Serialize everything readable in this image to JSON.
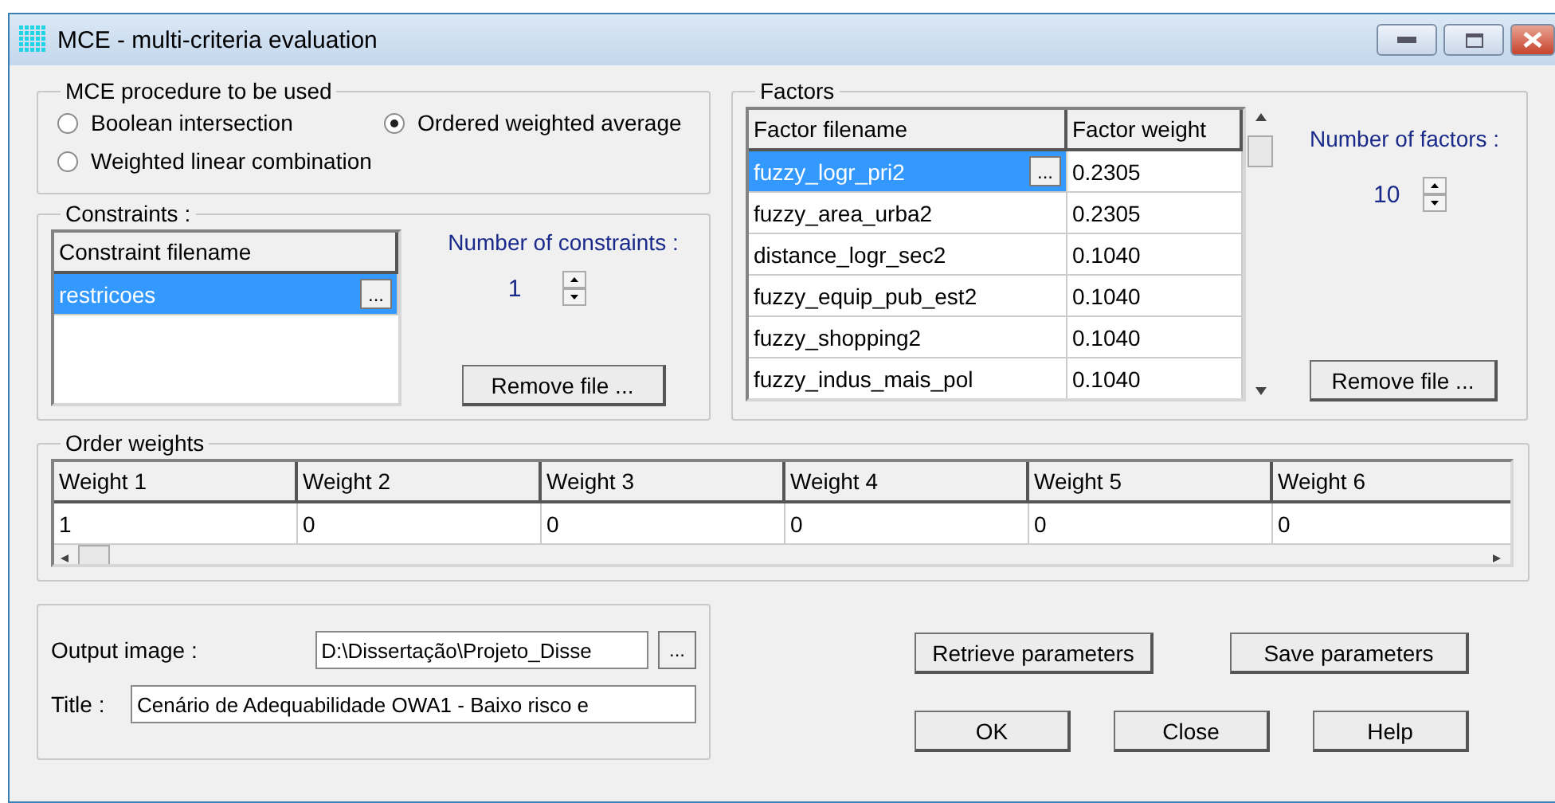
{
  "window": {
    "title": "MCE - multi-criteria evaluation"
  },
  "procedure": {
    "label": "MCE procedure to be used",
    "options": [
      {
        "label": "Boolean intersection",
        "selected": false
      },
      {
        "label": "Ordered weighted average",
        "selected": true
      },
      {
        "label": "Weighted linear combination",
        "selected": false
      }
    ]
  },
  "constraints": {
    "label": "Constraints :",
    "column": "Constraint filename",
    "rows": [
      {
        "filename": "restricoes",
        "selected": true,
        "browse": "..."
      }
    ],
    "count_label": "Number of constraints :",
    "count": "1",
    "button": "Remove file ..."
  },
  "factors": {
    "label": "Factors",
    "columns": [
      "Factor filename",
      "Factor weight"
    ],
    "rows": [
      {
        "filename": "fuzzy_logr_pri2",
        "weight": "0.2305",
        "selected": true,
        "browse": "..."
      },
      {
        "filename": "fuzzy_area_urba2",
        "weight": "0.2305",
        "selected": false
      },
      {
        "filename": "distance_logr_sec2",
        "weight": "0.1040",
        "selected": false
      },
      {
        "filename": "fuzzy_equip_pub_est2",
        "weight": "0.1040",
        "selected": false
      },
      {
        "filename": "fuzzy_shopping2",
        "weight": "0.1040",
        "selected": false
      },
      {
        "filename": "fuzzy_indus_mais_pol",
        "weight": "0.1040",
        "selected": false
      }
    ],
    "count_label": "Number of factors :",
    "count": "10",
    "button": "Remove file ..."
  },
  "order_weights": {
    "label": "Order weights",
    "columns": [
      "Weight 1",
      "Weight 2",
      "Weight 3",
      "Weight 4",
      "Weight 5",
      "Weight 6"
    ],
    "values": [
      "1",
      "0",
      "0",
      "0",
      "0",
      "0"
    ]
  },
  "output": {
    "image_label": "Output image :",
    "image_value": "D:\\Dissertação\\Projeto_Disse",
    "browse": "...",
    "title_label": "Title :",
    "title_value": "Cenário de Adequabilidade OWA1 - Baixo risco e"
  },
  "buttons": [
    {
      "label": "Retrieve parameters"
    },
    {
      "label": "Save parameters"
    },
    {
      "label": "OK"
    },
    {
      "label": "Close"
    },
    {
      "label": "Help"
    }
  ]
}
